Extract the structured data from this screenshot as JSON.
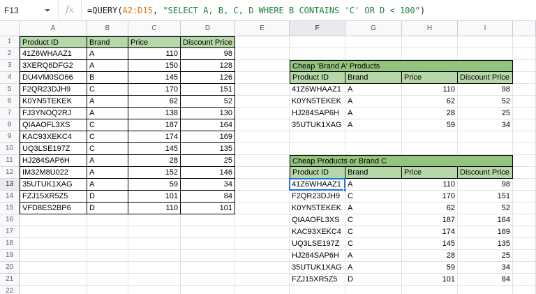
{
  "formula_bar": {
    "name_box": "F13",
    "fx_label": "fx",
    "formula_parts": [
      {
        "text": "=QUERY(",
        "color": "#202124"
      },
      {
        "text": "A2:D15",
        "color": "#e8710a"
      },
      {
        "text": ", ",
        "color": "#202124"
      },
      {
        "text": "\"SELECT A, B, C, D WHERE B CONTAINS 'C' OR D < 100\"",
        "color": "#188038"
      },
      {
        "text": ")",
        "color": "#202124"
      }
    ]
  },
  "grid": {
    "column_headers": [
      "A",
      "B",
      "C",
      "D",
      "E",
      "F",
      "G",
      "H",
      "I"
    ],
    "visible_rows": 22,
    "selected_cell": {
      "column": "F",
      "row": 13,
      "ref": "F13"
    }
  },
  "tables": {
    "main": {
      "anchor": {
        "column": "A",
        "row": 1
      },
      "headers": [
        "Product ID",
        "Brand",
        "Price",
        "Discount Price"
      ],
      "rows": [
        [
          "41Z6WHAAZ1",
          "A",
          110,
          98
        ],
        [
          "3XERQ6DFG2",
          "A",
          150,
          128
        ],
        [
          "DU4VM0SO66",
          "B",
          145,
          126
        ],
        [
          "F2QR23DJH9",
          "C",
          170,
          151
        ],
        [
          "K0YN5TEKEK",
          "A",
          62,
          52
        ],
        [
          "FJ3YNOQ2RJ",
          "A",
          138,
          130
        ],
        [
          "QIAAOFL3XS",
          "C",
          187,
          164
        ],
        [
          "KAC93XEKC4",
          "C",
          174,
          169
        ],
        [
          "UQ3LSE197Z",
          "C",
          145,
          135
        ],
        [
          "HJ284SAP6H",
          "A",
          28,
          25
        ],
        [
          "IM32M8U022",
          "A",
          152,
          146
        ],
        [
          "35UTUK1XAG",
          "A",
          59,
          34
        ],
        [
          "FZJ15XR5Z5",
          "D",
          101,
          84
        ],
        [
          "VFD8ES2BP6",
          "D",
          110,
          101
        ]
      ]
    },
    "brand_a": {
      "anchor": {
        "column": "F",
        "row": 3
      },
      "title": "Cheap 'Brand A' Products",
      "headers": [
        "Product ID",
        "Brand",
        "Price",
        "Discount Price"
      ],
      "rows": [
        [
          "41Z6WHAAZ1",
          "A",
          110,
          98
        ],
        [
          "K0YN5TEKEK",
          "A",
          62,
          52
        ],
        [
          "HJ284SAP6H",
          "A",
          28,
          25
        ],
        [
          "35UTUK1XAG",
          "A",
          59,
          34
        ]
      ]
    },
    "cheap_or_c": {
      "anchor": {
        "column": "F",
        "row": 11
      },
      "title": "Cheap Products or Brand C",
      "headers": [
        "Product ID",
        "Brand",
        "Price",
        "Discount Price"
      ],
      "rows": [
        [
          "41Z6WHAAZ1",
          "A",
          110,
          98
        ],
        [
          "F2QR23DJH9",
          "C",
          170,
          151
        ],
        [
          "K0YN5TEKEK",
          "A",
          62,
          52
        ],
        [
          "QIAAOFL3XS",
          "C",
          187,
          164
        ],
        [
          "KAC93XEKC4",
          "C",
          174,
          169
        ],
        [
          "UQ3LSE197Z",
          "C",
          145,
          135
        ],
        [
          "HJ284SAP6H",
          "A",
          28,
          25
        ],
        [
          "35UTUK1XAG",
          "A",
          59,
          34
        ],
        [
          "FZJ15XR5Z5",
          "D",
          101,
          84
        ]
      ]
    }
  },
  "colors": {
    "table_title_bg": "#93c47d",
    "table_header_bg": "#b6d7a8",
    "selection": "#1a73e8",
    "header_highlight": "#e8eaed"
  }
}
